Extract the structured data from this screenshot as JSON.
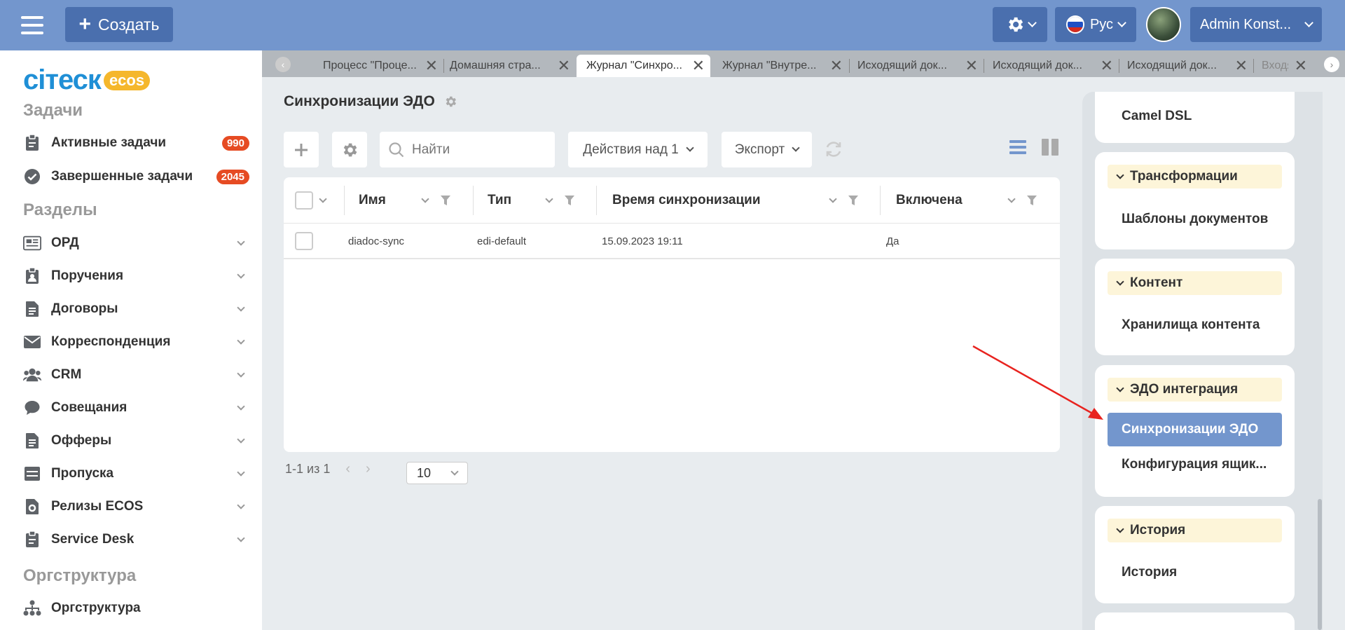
{
  "header": {
    "create_label": "Создать",
    "lang_label": "Рус",
    "user_label": "Admin Konst...",
    "colors": {
      "header_bg": "#7396cd",
      "button_bg": "#4a6fae"
    }
  },
  "logo": {
    "text": "ciтеск",
    "badge": "ecos"
  },
  "sidebar": {
    "sections": [
      {
        "title": "Задачи"
      },
      {
        "title": "Разделы"
      },
      {
        "title": "Оргструктура"
      }
    ],
    "tasks": [
      {
        "label": "Активные задачи",
        "badge": "990",
        "icon": "clipboard-icon"
      },
      {
        "label": "Завершенные задачи",
        "badge": "2045",
        "icon": "check-circle-icon"
      }
    ],
    "items": [
      {
        "label": "ОРД",
        "icon": "newspaper-icon"
      },
      {
        "label": "Поручения",
        "icon": "clipboard-person-icon"
      },
      {
        "label": "Договоры",
        "icon": "document-icon"
      },
      {
        "label": "Корреспонденция",
        "icon": "envelope-icon"
      },
      {
        "label": "CRM",
        "icon": "users-icon"
      },
      {
        "label": "Совещания",
        "icon": "chat-icon"
      },
      {
        "label": "Офферы",
        "icon": "document-icon"
      },
      {
        "label": "Пропуска",
        "icon": "pass-icon"
      },
      {
        "label": "Релизы ECOS",
        "icon": "gear-doc-icon"
      },
      {
        "label": "Service Desk",
        "icon": "clipboard-icon"
      }
    ],
    "org_item": {
      "label": "Оргструктура",
      "icon": "org-chart-icon"
    }
  },
  "tabs": [
    {
      "label": "Процесс \"Проце..."
    },
    {
      "label": "Домашняя стра..."
    },
    {
      "label": "Журнал \"Синхро...",
      "active": true
    },
    {
      "label": "Журнал \"Внутре..."
    },
    {
      "label": "Исходящий док..."
    },
    {
      "label": "Исходящий док..."
    },
    {
      "label": "Исходящий док..."
    },
    {
      "label": "Входя..."
    }
  ],
  "main": {
    "title": "Синхронизации ЭДО",
    "search_placeholder": "Найти",
    "actions_label": "Действия над 1",
    "export_label": "Экспорт",
    "columns": [
      "Имя",
      "Тип",
      "Время синхронизации",
      "Включена"
    ],
    "rows": [
      {
        "name": "diadoc-sync",
        "type": "edi-default",
        "time": "15.09.2023 19:11",
        "enabled": "Да"
      }
    ],
    "pager_text": "1-1 из 1",
    "page_size": "10"
  },
  "rpanel": {
    "top_link": "Camel DSL",
    "groups": [
      {
        "title": "Трансформации",
        "links": [
          "Шаблоны документов"
        ]
      },
      {
        "title": "Контент",
        "links": [
          "Хранилища контента"
        ]
      },
      {
        "title": "ЭДО интеграция",
        "links": [
          "Синхронизации ЭДО",
          "Конфигурация ящик..."
        ],
        "selected": 0
      },
      {
        "title": "История",
        "links": [
          "История"
        ]
      }
    ]
  }
}
